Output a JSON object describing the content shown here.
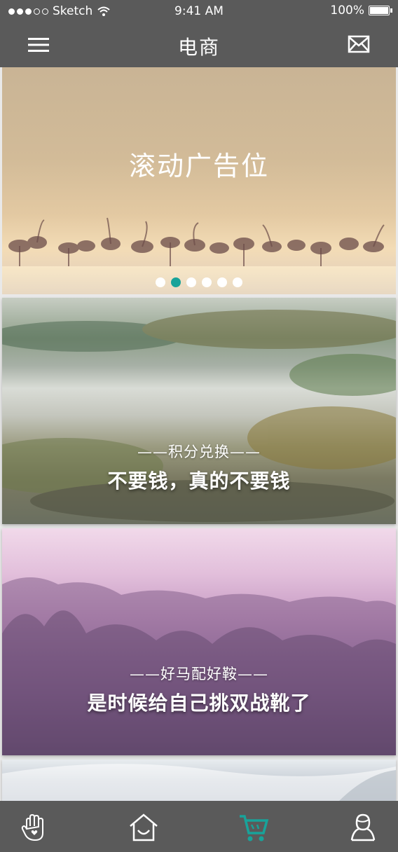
{
  "status_bar": {
    "carrier": "Sketch",
    "time": "9:41 AM",
    "battery": "100%"
  },
  "nav": {
    "title": "电商",
    "left_icon": "menu-icon",
    "right_icon": "mail-icon"
  },
  "banner": {
    "title": "滚动广告位",
    "pager_count": 6,
    "active_index": 1
  },
  "cards": [
    {
      "subtitle": "——积分兑换——",
      "headline": "不要钱，真的不要钱"
    },
    {
      "subtitle": "——好马配好鞍——",
      "headline": "是时候给自己挑双战靴了"
    }
  ],
  "tabbar": {
    "items": [
      "hand-icon",
      "home-icon",
      "cart-icon",
      "profile-icon"
    ],
    "active_index": 2,
    "active_color": "#18a39a"
  },
  "colors": {
    "bar_background": "#5a5a5a",
    "accent": "#18a39a"
  }
}
